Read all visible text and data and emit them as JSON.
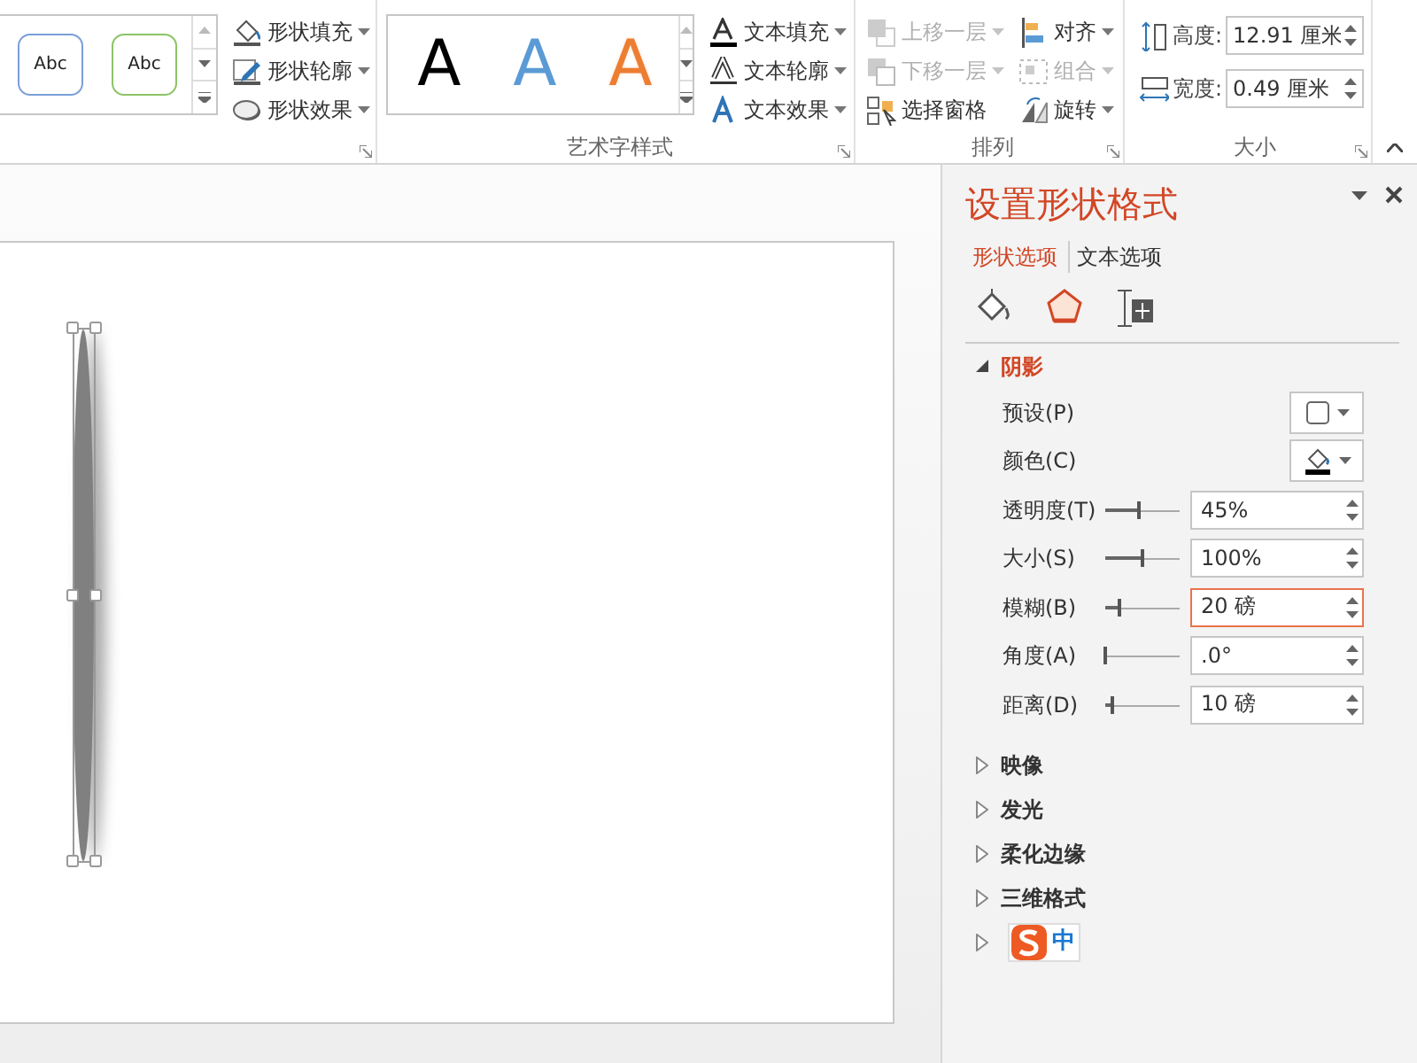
{
  "ribbon": {
    "shape_styles": {
      "gallery": [
        {
          "label": "Abc",
          "color": "#7a9fd9"
        },
        {
          "label": "Abc",
          "color": "#8cc466"
        }
      ],
      "commands": [
        {
          "label": "形状填充",
          "kind": "fill",
          "disabled": false,
          "dropdown": true
        },
        {
          "label": "形状轮廓",
          "kind": "outline",
          "disabled": false,
          "dropdown": true
        },
        {
          "label": "形状效果",
          "kind": "effect",
          "disabled": false,
          "dropdown": true
        }
      ]
    },
    "wordart_styles": {
      "title": "艺术字样式",
      "gallery": [
        {
          "label": "A",
          "kind": "solid",
          "color": "#000000"
        },
        {
          "label": "A",
          "kind": "solid",
          "color": "#5b9bd5"
        },
        {
          "label": "A",
          "kind": "outline",
          "color": "#ed7d31"
        }
      ],
      "commands": [
        {
          "label": "文本填充",
          "kind": "text-fill",
          "disabled": false,
          "dropdown": true
        },
        {
          "label": "文本轮廓",
          "kind": "text-outline",
          "disabled": false,
          "dropdown": true
        },
        {
          "label": "文本效果",
          "kind": "text-effect",
          "disabled": false,
          "dropdown": true
        }
      ]
    },
    "arrange": {
      "title": "排列",
      "columns": [
        [
          {
            "label": "上移一层",
            "kind": "forward",
            "disabled": true,
            "dropdown": true
          },
          {
            "label": "下移一层",
            "kind": "backward",
            "disabled": true,
            "dropdown": true
          },
          {
            "label": "选择窗格",
            "kind": "pane",
            "disabled": false,
            "dropdown": false
          }
        ],
        [
          {
            "label": "对齐",
            "kind": "align",
            "disabled": false,
            "dropdown": true
          },
          {
            "label": "组合",
            "kind": "group",
            "disabled": true,
            "dropdown": true
          },
          {
            "label": "旋转",
            "kind": "rotate",
            "disabled": false,
            "dropdown": true
          }
        ]
      ]
    },
    "size": {
      "title": "大小",
      "fields": [
        {
          "label": "高度:",
          "kind": "height",
          "value": "12.91 厘米"
        },
        {
          "label": "宽度:",
          "kind": "width",
          "value": "0.49 厘米"
        }
      ]
    }
  },
  "panel": {
    "title": "设置形状格式",
    "tabs": [
      {
        "label": "形状选项",
        "selected": true
      },
      {
        "label": "文本选项",
        "selected": false
      }
    ],
    "icon_tabs": [
      {
        "kind": "fill",
        "selected": false
      },
      {
        "kind": "effects",
        "selected": true
      },
      {
        "kind": "size",
        "selected": false
      }
    ],
    "sections": [
      {
        "label": "阴影",
        "expanded": true,
        "rows": [
          {
            "kind": "preset-picker",
            "label": "预设(P)"
          },
          {
            "kind": "color-picker",
            "label": "颜色(C)"
          },
          {
            "kind": "slider",
            "label": "透明度(T)",
            "level": 0.45,
            "value": "45%",
            "focused": false
          },
          {
            "kind": "slider",
            "label": "大小(S)",
            "level": 0.5,
            "value": "100%",
            "focused": false
          },
          {
            "kind": "slider",
            "label": "模糊(B)",
            "level": 0.2,
            "value": "20 磅",
            "focused": true
          },
          {
            "kind": "slider",
            "label": "角度(A)",
            "level": 0,
            "value": ".0°",
            "focused": false
          },
          {
            "kind": "slider",
            "label": "距离(D)",
            "level": 0.1,
            "value": "10 磅",
            "focused": false
          }
        ]
      },
      {
        "label": "映像",
        "expanded": false
      },
      {
        "label": "发光",
        "expanded": false
      },
      {
        "label": "柔化边缘",
        "expanded": false
      },
      {
        "label": "三维格式",
        "expanded": false
      }
    ]
  },
  "ime_toolbar": {
    "label": "中"
  }
}
